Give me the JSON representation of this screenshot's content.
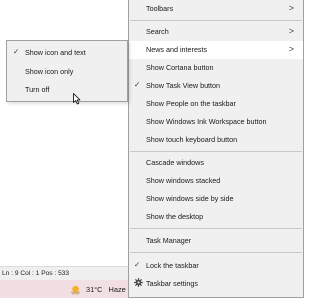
{
  "status_bar": {
    "position_text": "Ln : 9   Col : 1   Pos : 533"
  },
  "taskbar": {
    "temperature": "31°C",
    "condition": "Haze",
    "weather_icon": "sun-haze-icon"
  },
  "context_menu": {
    "toolbars": "Toolbars",
    "search": "Search",
    "news_and_interests": "News and interests",
    "show_cortana_button": "Show Cortana button",
    "show_task_view_button": "Show Task View button",
    "show_people": "Show People on the taskbar",
    "show_windows_ink": "Show Windows Ink Workspace button",
    "show_touch_keyboard": "Show touch keyboard button",
    "cascade_windows": "Cascade windows",
    "show_windows_stacked": "Show windows stacked",
    "show_windows_side_by_side": "Show windows side by side",
    "show_the_desktop": "Show the desktop",
    "task_manager": "Task Manager",
    "lock_the_taskbar": "Lock the taskbar",
    "taskbar_settings": "Taskbar settings",
    "check_glyph": "✓",
    "submenu_arrow": ">"
  },
  "submenu": {
    "show_icon_and_text": "Show icon and text",
    "show_icon_only": "Show icon only",
    "turn_off": "Turn off"
  }
}
